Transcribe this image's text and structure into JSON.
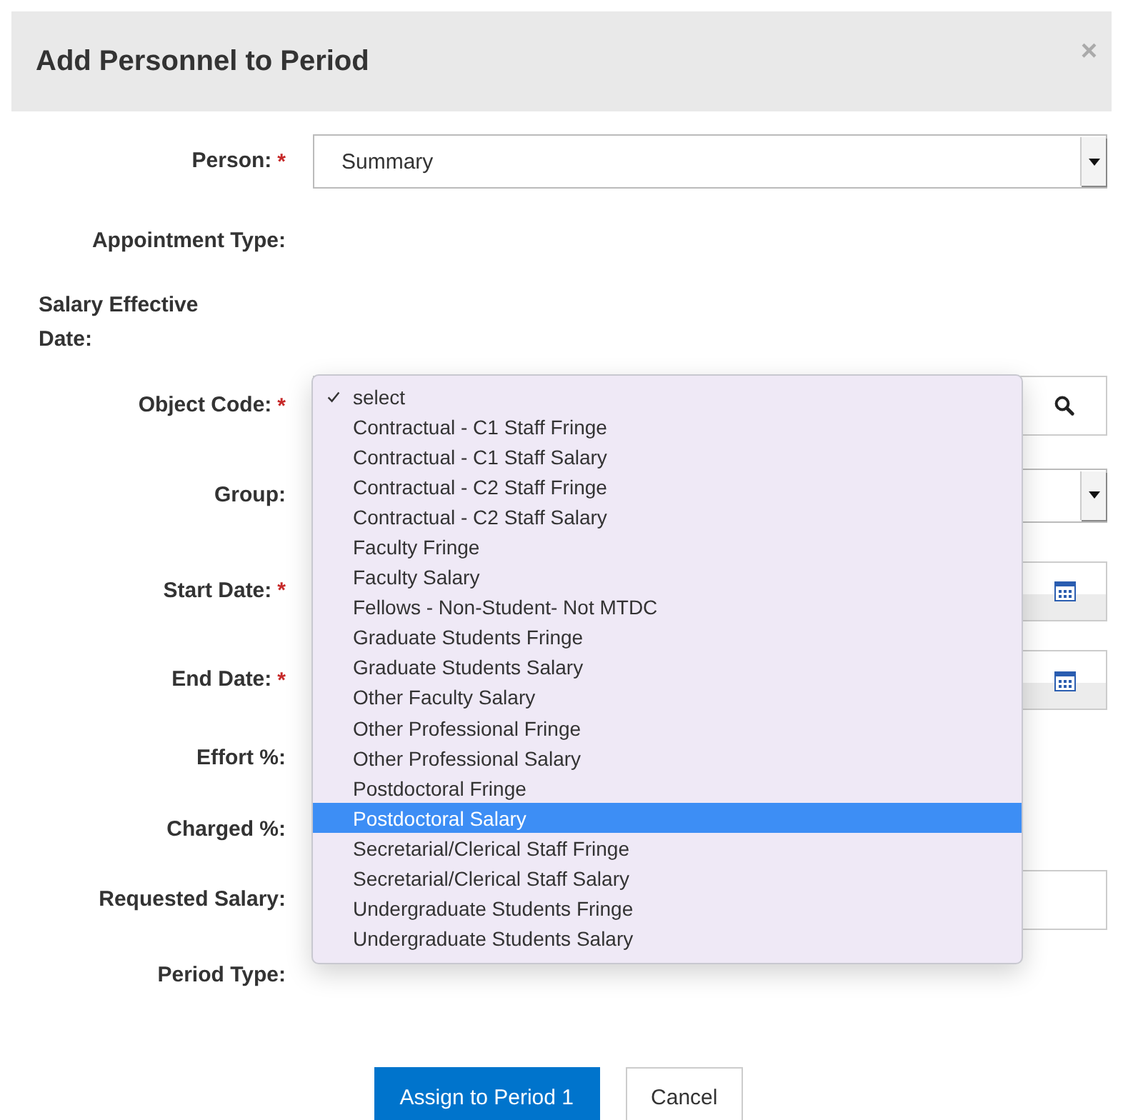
{
  "dialog": {
    "title": "Add Personnel to Period",
    "close": "×"
  },
  "fields": [
    {
      "label": "Person:",
      "marker": "*",
      "kind": "select",
      "value": "Summary"
    },
    {
      "label": "Appointment Type:",
      "kind": "none"
    },
    {
      "label": "Salary Effective Date:",
      "kind": "none",
      "stacked": true
    },
    {
      "label": "Object Code:",
      "marker": "*",
      "kind": "lookup"
    },
    {
      "label": "Group:",
      "kind": "select"
    },
    {
      "label": "Start Date:",
      "marker": "*",
      "kind": "date"
    },
    {
      "label": "End Date:",
      "marker": "*",
      "kind": "date"
    },
    {
      "label": "Effort %:",
      "kind": "none"
    },
    {
      "label": "Charged %:",
      "kind": "none"
    },
    {
      "label": "Requested Salary:",
      "kind": "input"
    },
    {
      "label": "Period Type:",
      "kind": "none"
    }
  ],
  "dropdown": {
    "options": [
      {
        "label": "select",
        "checked": true,
        "highlighted": false
      },
      {
        "label": "Contractual - C1 Staff Fringe",
        "checked": false,
        "highlighted": false
      },
      {
        "label": "Contractual - C1 Staff Salary",
        "checked": false,
        "highlighted": false
      },
      {
        "label": "Contractual - C2 Staff Fringe",
        "checked": false,
        "highlighted": false
      },
      {
        "label": "Contractual - C2 Staff Salary",
        "checked": false,
        "highlighted": false
      },
      {
        "label": "Faculty Fringe",
        "checked": false,
        "highlighted": false
      },
      {
        "label": "Faculty Salary",
        "checked": false,
        "highlighted": false
      },
      {
        "label": "Fellows - Non-Student- Not MTDC",
        "checked": false,
        "highlighted": false
      },
      {
        "label": "Graduate Students Fringe",
        "checked": false,
        "highlighted": false
      },
      {
        "label": "Graduate Students Salary",
        "checked": false,
        "highlighted": false
      },
      {
        "label": "Other Faculty Salary",
        "checked": false,
        "highlighted": false
      },
      {
        "label": "Other Professional Fringe",
        "checked": false,
        "highlighted": false
      },
      {
        "label": "Other Professional Salary",
        "checked": false,
        "highlighted": false
      },
      {
        "label": "Postdoctoral Fringe",
        "checked": false,
        "highlighted": false
      },
      {
        "label": "Postdoctoral Salary",
        "checked": false,
        "highlighted": true
      },
      {
        "label": "Secretarial/Clerical Staff Fringe",
        "checked": false,
        "highlighted": false
      },
      {
        "label": "Secretarial/Clerical Staff Salary",
        "checked": false,
        "highlighted": false
      },
      {
        "label": "Undergraduate Students Fringe",
        "checked": false,
        "highlighted": false
      },
      {
        "label": "Undergraduate Students Salary",
        "checked": false,
        "highlighted": false
      }
    ]
  },
  "buttons": [
    {
      "label": "Assign to Period 1",
      "kind": "primary"
    },
    {
      "label": "Cancel",
      "kind": "default"
    }
  ]
}
